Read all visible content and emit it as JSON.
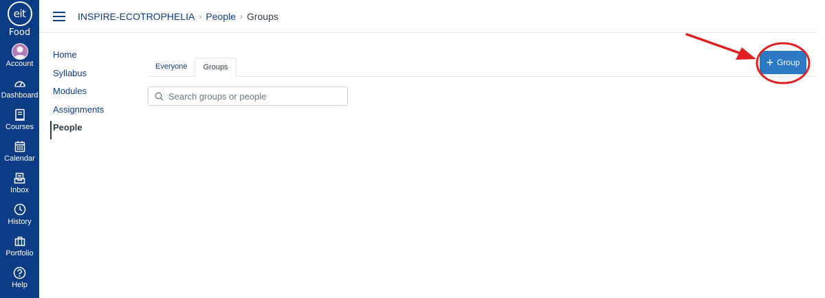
{
  "global_nav": {
    "logo_text": "eit",
    "logo_sub": "Food",
    "items": [
      {
        "label": "Account",
        "icon": "avatar"
      },
      {
        "label": "Dashboard",
        "icon": "dashboard-icon"
      },
      {
        "label": "Courses",
        "icon": "courses-icon"
      },
      {
        "label": "Calendar",
        "icon": "calendar-icon"
      },
      {
        "label": "Inbox",
        "icon": "inbox-icon"
      },
      {
        "label": "History",
        "icon": "history-icon"
      },
      {
        "label": "Portfolio",
        "icon": "portfolio-icon"
      },
      {
        "label": "Help",
        "icon": "help-icon"
      }
    ],
    "bg_color": "#0c3c86"
  },
  "header": {
    "breadcrumb": [
      "INSPIRE-ECOTROPHELIA",
      "People",
      "Groups"
    ],
    "separator": "›"
  },
  "course_nav": {
    "items": [
      "Home",
      "Syllabus",
      "Modules",
      "Assignments",
      "People"
    ],
    "active": "People"
  },
  "tabs": {
    "items": [
      "Everyone",
      "Groups"
    ],
    "active": "Groups"
  },
  "search": {
    "placeholder": "Search groups or people",
    "value": ""
  },
  "group_button": {
    "plus": "+",
    "label": "Group",
    "color": "#2d78c4"
  },
  "annotation": {
    "color": "#e02020"
  }
}
